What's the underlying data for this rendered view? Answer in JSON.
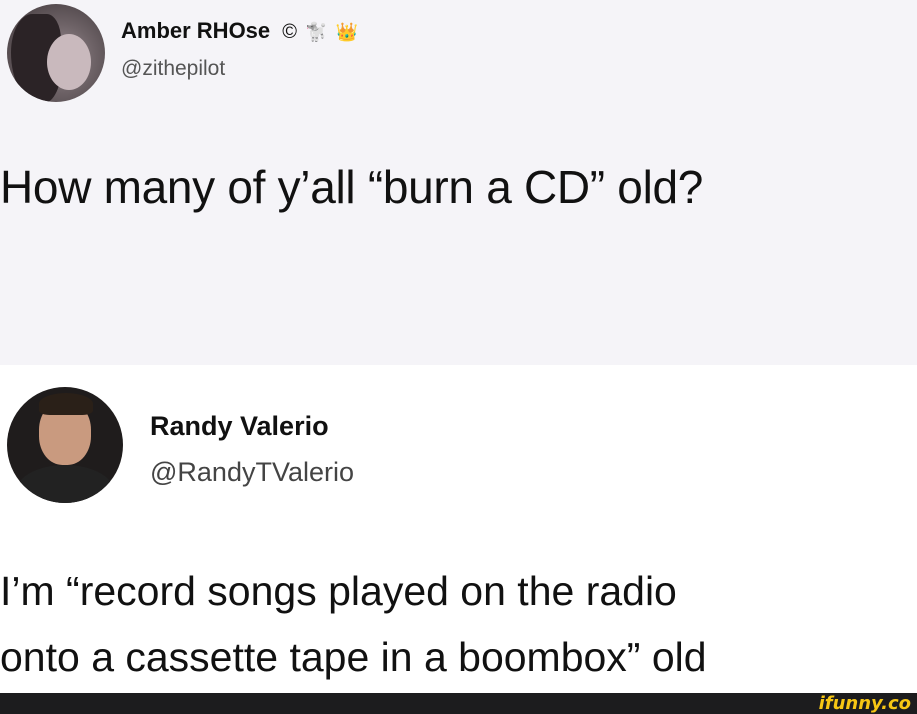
{
  "tweet1": {
    "display_name": "Amber RHOse",
    "badges": {
      "copyright": "©",
      "icons": [
        "poodle-icon",
        "crown-icon"
      ]
    },
    "handle": "@zithepilot",
    "text": "How many of y’all “burn a CD” old?"
  },
  "tweet2": {
    "display_name": "Randy Valerio",
    "handle": "@RandyTValerio",
    "text_line1": "I’m “record songs played on the radio",
    "text_line2": "onto a cassette tape in a boombox” old"
  },
  "footer": {
    "watermark": "ifunny.co"
  },
  "colors": {
    "tweet1_bg": "#f5f4f8",
    "tweet2_bg": "#ffffff",
    "footer_bg": "#1c1c1e",
    "watermark": "#f6c614"
  }
}
